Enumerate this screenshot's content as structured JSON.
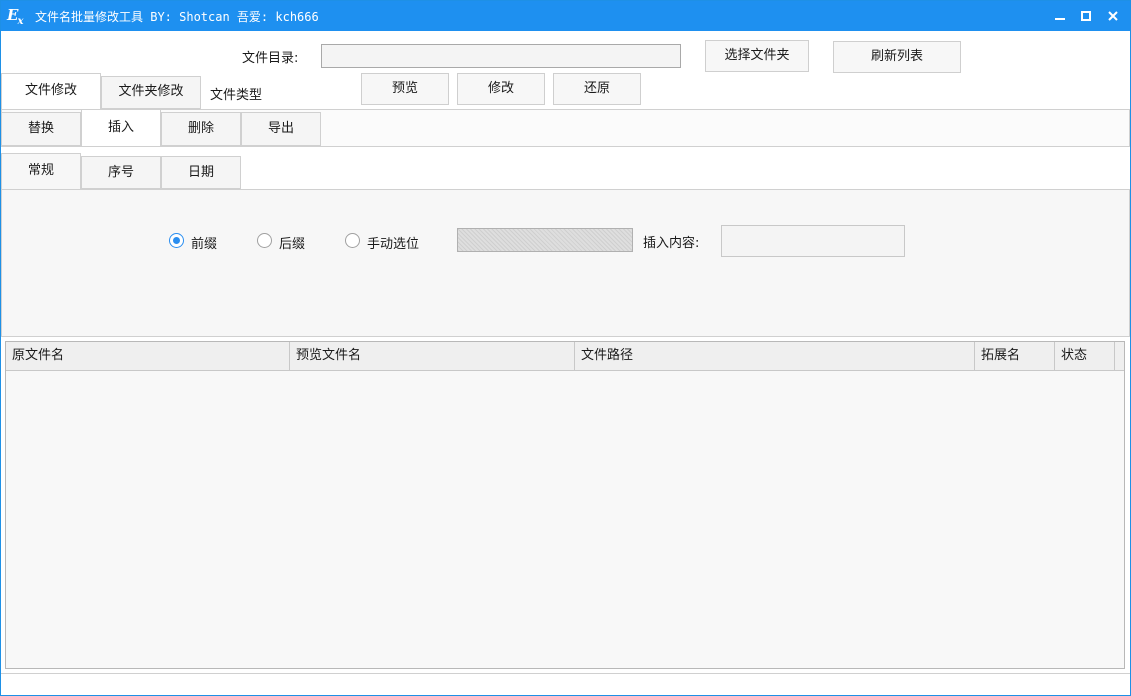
{
  "window": {
    "title": "文件名批量修改工具 BY: Shotcan 吾爱: kch666",
    "icon": "ex-app-icon",
    "accent": "#1e90f0"
  },
  "top": {
    "dir_label": "文件目录:",
    "dir_value": "",
    "choose_folder": "选择文件夹",
    "refresh_list": "刷新列表",
    "preview": "预览",
    "modify": "修改",
    "restore": "还原",
    "file_type_label": "文件类型"
  },
  "main_tabs": [
    "文件修改",
    "文件夹修改"
  ],
  "sub_tabs": [
    "替换",
    "插入",
    "删除",
    "导出"
  ],
  "insert_tabs": [
    "常规",
    "序号",
    "日期"
  ],
  "insert_options": {
    "prefix": "前缀",
    "suffix": "后缀",
    "manual": "手动选位",
    "content_label": "插入内容:",
    "content_value": "",
    "selected": "prefix"
  },
  "table": {
    "columns": [
      "原文件名",
      "预览文件名",
      "文件路径",
      "拓展名",
      "状态"
    ],
    "rows": []
  }
}
